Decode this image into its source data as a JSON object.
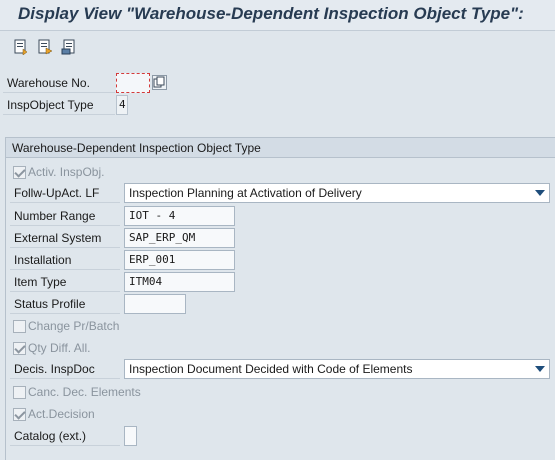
{
  "window": {
    "title": "Display View \"Warehouse-Dependent Inspection Object Type\": "
  },
  "toolbar": {
    "buttons": [
      {
        "icon": "other-entry-icon"
      },
      {
        "icon": "next-entry-icon"
      },
      {
        "icon": "print-icon"
      }
    ]
  },
  "header": {
    "warehouse_label": "Warehouse No.",
    "warehouse_value": "",
    "inspobj_label": "InspObject Type",
    "inspobj_value": "4"
  },
  "group": {
    "title": "Warehouse-Dependent Inspection Object Type",
    "activ_inspobj": {
      "label": "Activ. InspObj.",
      "checked": true
    },
    "follow_up": {
      "label": "Follw-UpAct. LF",
      "value": "Inspection Planning at Activation of Delivery"
    },
    "number_range": {
      "label": "Number Range",
      "value": "IOT - 4"
    },
    "external_system": {
      "label": "External System",
      "value": "SAP_ERP_QM"
    },
    "installation": {
      "label": "Installation",
      "value": "ERP_001"
    },
    "item_type": {
      "label": "Item Type",
      "value": "ITM04"
    },
    "status_profile": {
      "label": "Status Profile",
      "value": ""
    },
    "change_pr_batch": {
      "label": "Change Pr/Batch",
      "checked": false
    },
    "qty_diff": {
      "label": "Qty Diff. All.",
      "checked": true
    },
    "decis_inspdoc": {
      "label": "Decis. InspDoc",
      "value": "Inspection Document Decided with Code of Elements"
    },
    "canc_dec": {
      "label": "Canc. Dec. Elements",
      "checked": false
    },
    "act_decision": {
      "label": "Act.Decision",
      "checked": true
    },
    "catalog_ext": {
      "label": "Catalog (ext.)",
      "value": ""
    }
  },
  "colors": {
    "title": "#273b52",
    "background": "#dfe6ec",
    "focus_border": "#d33a3a"
  }
}
